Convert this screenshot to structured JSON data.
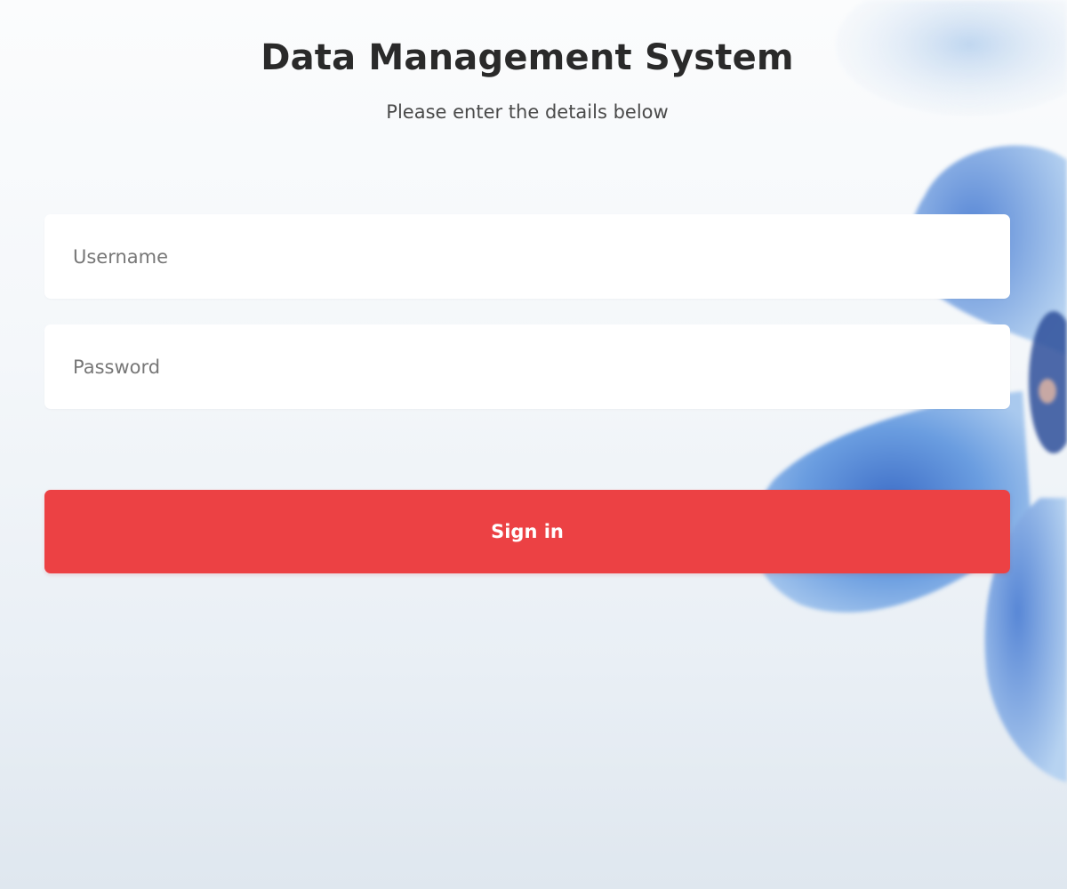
{
  "page": {
    "title": "Data Management System",
    "subtitle": "Please enter the details below"
  },
  "form": {
    "username_placeholder": "Username",
    "username_value": "",
    "password_placeholder": "Password",
    "password_value": "",
    "signin_label": "Sign in"
  },
  "colors": {
    "accent": "#ec4144",
    "title_text": "#2a2a2a",
    "field_background": "#ffffff",
    "flower": "#5b8fd8"
  }
}
